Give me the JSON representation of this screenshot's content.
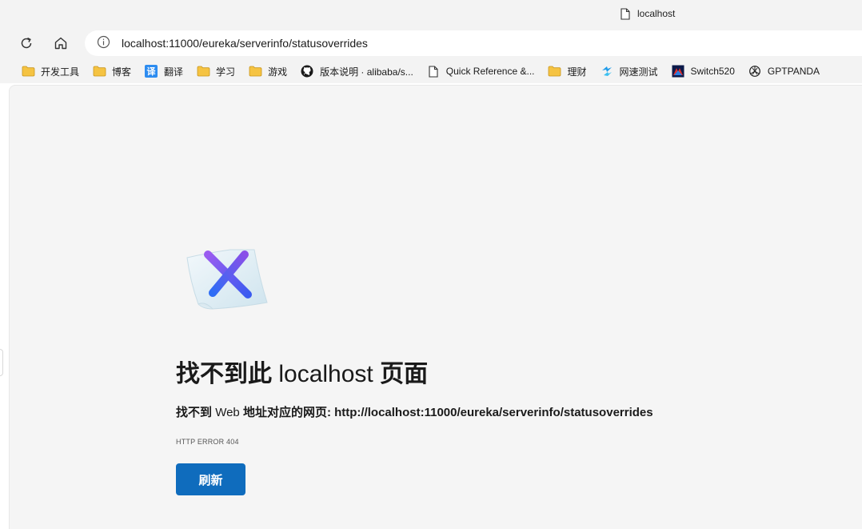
{
  "tab": {
    "title": "localhost"
  },
  "address": {
    "url": "localhost:11000/eureka/serverinfo/statusoverrides"
  },
  "bookmarks": [
    {
      "label": "开发工具",
      "icon": "folder-icon"
    },
    {
      "label": "博客",
      "icon": "folder-icon"
    },
    {
      "label": "翻译",
      "icon": "translate-icon"
    },
    {
      "label": "学习",
      "icon": "folder-icon"
    },
    {
      "label": "游戏",
      "icon": "folder-icon"
    },
    {
      "label": "版本说明 · alibaba/s...",
      "icon": "github-icon"
    },
    {
      "label": "Quick Reference &...",
      "icon": "page-icon"
    },
    {
      "label": "理财",
      "icon": "folder-icon"
    },
    {
      "label": "网速测试",
      "icon": "speedtest-icon"
    },
    {
      "label": "Switch520",
      "icon": "switch520-icon"
    },
    {
      "label": "GPTPANDA",
      "icon": "openai-icon"
    }
  ],
  "translate_glyph": "译",
  "error": {
    "title_prefix": "找不到此",
    "title_host": "localhost",
    "title_suffix": "页面",
    "desc_prefix": "找不到",
    "desc_web": "Web",
    "desc_middle": "地址对应的网页:",
    "desc_url": "http://localhost:11000/eureka/serverinfo/statusoverrides",
    "code": "HTTP ERROR 404",
    "reload_label": "刷新"
  },
  "colors": {
    "accent": "#0f6cbd",
    "content_bg": "#f5f5f5",
    "chrome_bg": "#f3f3f3",
    "folder": "#f5c342"
  }
}
